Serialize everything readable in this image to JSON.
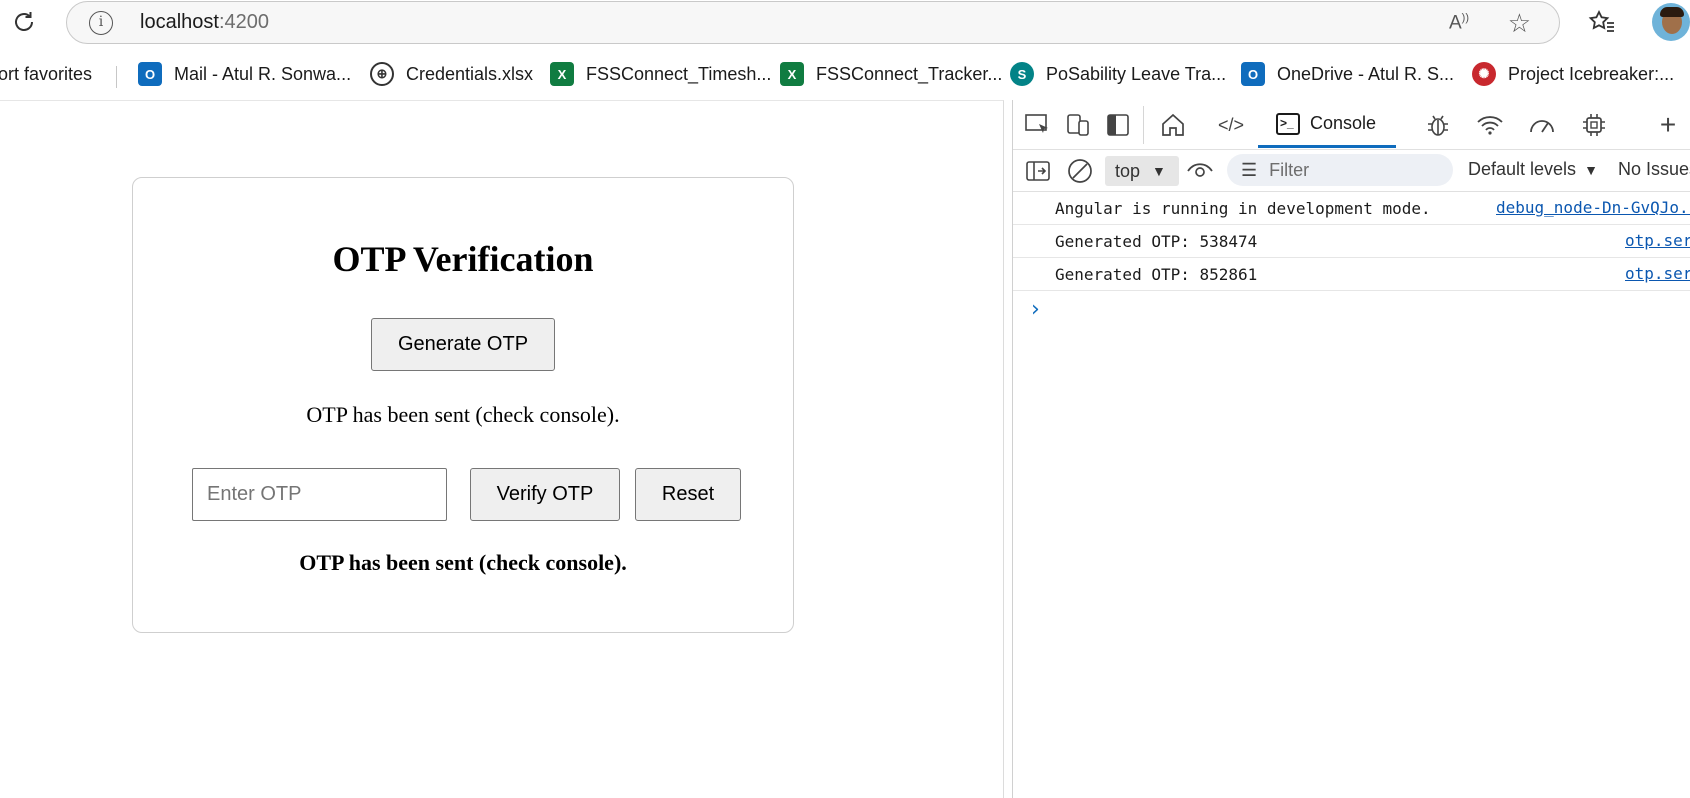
{
  "browser": {
    "url_host": "localhost",
    "url_port": ":4200"
  },
  "favorites": [
    {
      "label": "ort favorites",
      "icon": "folder-icon"
    },
    {
      "label": "Mail - Atul R. Sonwa...",
      "icon": "outlook-icon"
    },
    {
      "label": "Credentials.xlsx",
      "icon": "globe-icon"
    },
    {
      "label": "FSSConnect_Timesh...",
      "icon": "excel-icon"
    },
    {
      "label": "FSSConnect_Tracker...",
      "icon": "excel-icon"
    },
    {
      "label": "PoSability Leave Tra...",
      "icon": "sharepoint-icon"
    },
    {
      "label": "OneDrive - Atul R. S...",
      "icon": "outlook-icon"
    },
    {
      "label": "Project Icebreaker:...",
      "icon": "icebreaker-icon"
    }
  ],
  "page": {
    "title": "OTP Verification",
    "generate_label": "Generate OTP",
    "sent_message": "OTP has been sent (check console).",
    "otp_placeholder": "Enter OTP",
    "verify_label": "Verify OTP",
    "reset_label": "Reset",
    "status_message": "OTP has been sent (check console)."
  },
  "devtools": {
    "console_tab": "Console",
    "context": "top",
    "filter_placeholder": "Filter",
    "levels": "Default levels",
    "issues": "No Issues",
    "lines": [
      {
        "message": "Angular is running in development mode.",
        "source": "debug_node-Dn-GvQJo.js"
      },
      {
        "message": "Generated OTP: 538474",
        "source": "otp.service.ts"
      },
      {
        "message": "Generated OTP: 852861",
        "source": "otp.service.ts"
      }
    ]
  },
  "colors": {
    "accent": "#0f6cbd",
    "link": "#0b57b0",
    "excel": "#107c41",
    "outlook": "#0f6cbd"
  }
}
